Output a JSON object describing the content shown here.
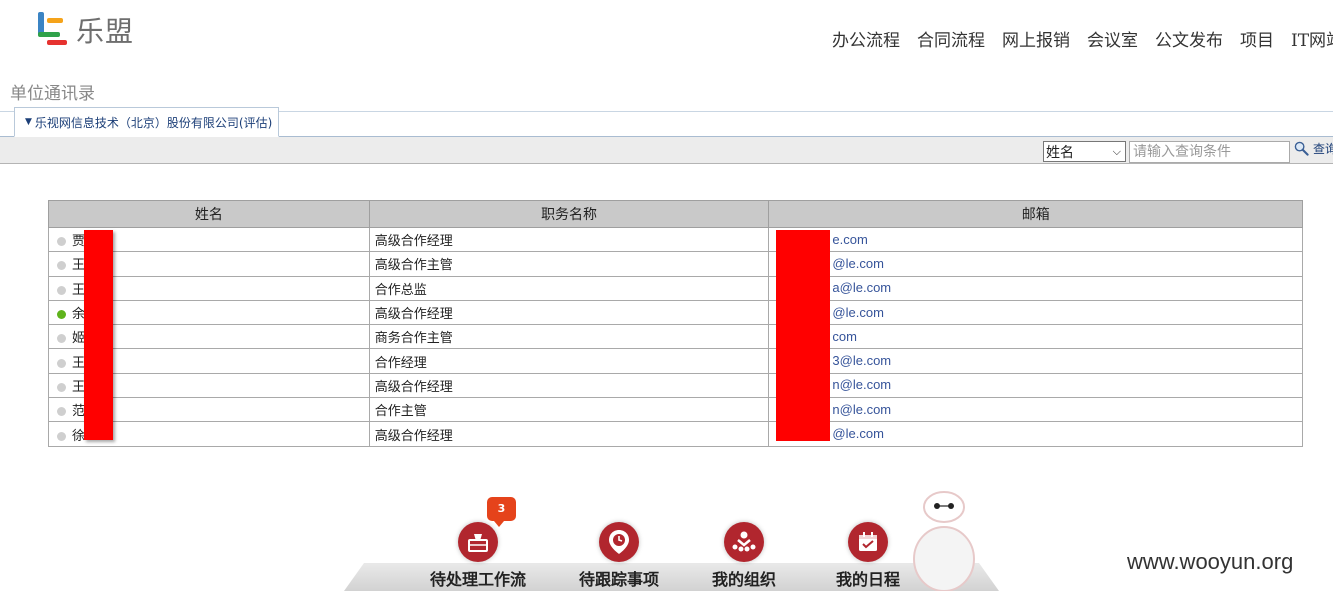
{
  "brand": {
    "name": "乐盟"
  },
  "nav": [
    "办公流程",
    "合同流程",
    "网上报销",
    "会议室",
    "公文发布",
    "项目",
    "IT网站"
  ],
  "page_title": "单位通讯录",
  "org_tab": {
    "label": "乐视网信息技术（北京）股份有限公司(评估)"
  },
  "search": {
    "field": "姓名",
    "placeholder": "请输入查询条件",
    "button_label": "查询"
  },
  "table": {
    "headers": [
      "姓名",
      "职务名称",
      "邮箱"
    ],
    "rows": [
      {
        "name": "贾",
        "title": "高级合作经理",
        "email": "e.com",
        "online": false
      },
      {
        "name": "王",
        "title": "高级合作主管",
        "email": "@le.com",
        "online": false
      },
      {
        "name": "王",
        "title": "合作总监",
        "email": "a@le.com",
        "online": false
      },
      {
        "name": "余",
        "title": "高级合作经理",
        "email": "@le.com",
        "online": true
      },
      {
        "name": "姬",
        "title": "商务合作主管",
        "email": "com",
        "online": false
      },
      {
        "name": "王",
        "title": "合作经理",
        "email": "3@le.com",
        "online": false
      },
      {
        "name": "王",
        "title": "高级合作经理",
        "email": "n@le.com",
        "online": false
      },
      {
        "name": "范",
        "title": "合作主管",
        "email": "n@le.com",
        "online": false
      },
      {
        "name": "徐",
        "title": "高级合作经理",
        "email": "@le.com",
        "online": false
      }
    ]
  },
  "dock": {
    "badge_count": "3",
    "items": [
      {
        "label": "待处理工作流",
        "icon": "inbox-icon"
      },
      {
        "label": "待跟踪事项",
        "icon": "location-clock-icon"
      },
      {
        "label": "我的组织",
        "icon": "people-icon"
      },
      {
        "label": "我的日程",
        "icon": "calendar-icon"
      }
    ]
  },
  "colors": {
    "accent_red": "#b1262e",
    "link_blue": "#36549a",
    "redaction": "#ff0000",
    "online_green": "#5fb31c"
  },
  "watermark": "www.wooyun.org"
}
